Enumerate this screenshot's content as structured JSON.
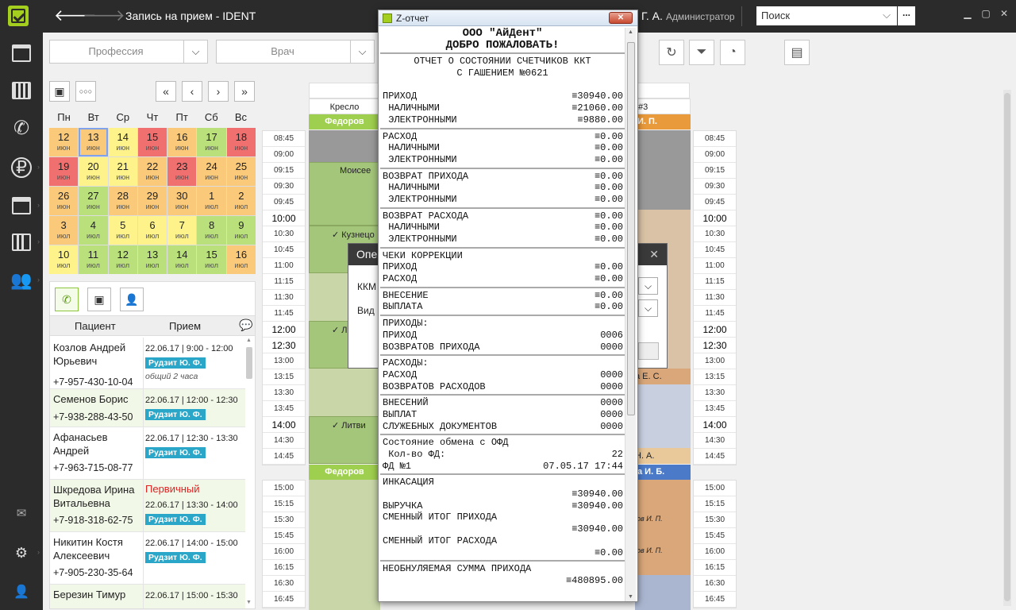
{
  "topbar": {
    "title": "Запись на прием  -  IDENT",
    "user_name": "Г. А.",
    "user_role": "Администратор",
    "search_placeholder": "Поиск",
    "search_more": "..."
  },
  "filters": {
    "profession": "Профессия",
    "doctor": "Врач"
  },
  "calendar": {
    "weekdays": [
      "Пн",
      "Вт",
      "Ср",
      "Чт",
      "Пт",
      "Сб",
      "Вс"
    ],
    "days": [
      {
        "d": "12",
        "m": "июн",
        "c": "orange"
      },
      {
        "d": "13",
        "m": "июн",
        "c": "orange",
        "sel": true
      },
      {
        "d": "14",
        "m": "июн",
        "c": "yellow"
      },
      {
        "d": "15",
        "m": "июн",
        "c": "red"
      },
      {
        "d": "16",
        "m": "июн",
        "c": "orange"
      },
      {
        "d": "17",
        "m": "июн",
        "c": "green"
      },
      {
        "d": "18",
        "m": "июн",
        "c": "red"
      },
      {
        "d": "19",
        "m": "июн",
        "c": "red"
      },
      {
        "d": "20",
        "m": "июн",
        "c": "yellow"
      },
      {
        "d": "21",
        "m": "июн",
        "c": "yellow"
      },
      {
        "d": "22",
        "m": "июн",
        "c": "orange"
      },
      {
        "d": "23",
        "m": "июн",
        "c": "red"
      },
      {
        "d": "24",
        "m": "июн",
        "c": "orange"
      },
      {
        "d": "25",
        "m": "июн",
        "c": "orange"
      },
      {
        "d": "26",
        "m": "июн",
        "c": "orange"
      },
      {
        "d": "27",
        "m": "июн",
        "c": "green"
      },
      {
        "d": "28",
        "m": "июн",
        "c": "orange"
      },
      {
        "d": "29",
        "m": "июн",
        "c": "orange"
      },
      {
        "d": "30",
        "m": "июн",
        "c": "orange"
      },
      {
        "d": "1",
        "m": "июл",
        "c": "orange"
      },
      {
        "d": "2",
        "m": "июл",
        "c": "orange"
      },
      {
        "d": "3",
        "m": "июл",
        "c": "orange"
      },
      {
        "d": "4",
        "m": "июл",
        "c": "green"
      },
      {
        "d": "5",
        "m": "июл",
        "c": "yellow"
      },
      {
        "d": "6",
        "m": "июл",
        "c": "yellow"
      },
      {
        "d": "7",
        "m": "июл",
        "c": "yellow"
      },
      {
        "d": "8",
        "m": "июл",
        "c": "green"
      },
      {
        "d": "9",
        "m": "июл",
        "c": "green"
      },
      {
        "d": "10",
        "m": "июл",
        "c": "yellow"
      },
      {
        "d": "11",
        "m": "июл",
        "c": "green"
      },
      {
        "d": "12",
        "m": "июл",
        "c": "green"
      },
      {
        "d": "13",
        "m": "июл",
        "c": "green"
      },
      {
        "d": "14",
        "m": "июл",
        "c": "green"
      },
      {
        "d": "15",
        "m": "июл",
        "c": "green"
      },
      {
        "d": "16",
        "m": "июл",
        "c": "orange"
      }
    ]
  },
  "patients": {
    "col_patient": "Пациент",
    "col_visit": "Прием",
    "rows": [
      {
        "name": "Козлов Андрей Юрьевич",
        "phone": "+7-957-430-10-04",
        "date": "22.06.17 | 9:00 - 12:00",
        "doctor": "Рудзит Ю. Ф.",
        "note": "общий 2 часа",
        "primary": ""
      },
      {
        "name": "Семенов Борис",
        "phone": "+7-938-288-43-50",
        "date": "22.06.17 | 12:00 - 12:30",
        "doctor": "Рудзит Ю. Ф.",
        "note": "",
        "primary": ""
      },
      {
        "name": "Афанасьев Андрей",
        "phone": "+7-963-715-08-77",
        "date": "22.06.17 | 12:30 - 13:30",
        "doctor": "Рудзит Ю. Ф.",
        "note": "",
        "primary": ""
      },
      {
        "name": "Шкредова Ирина Витальевна",
        "phone": "+7-918-318-62-75",
        "date": "22.06.17 | 13:30 - 14:00",
        "doctor": "Рудзит Ю. Ф.",
        "note": "",
        "primary": "Первичный"
      },
      {
        "name": "Никитин Костя Алексеевич",
        "phone": "+7-905-230-35-64",
        "date": "22.06.17 | 14:00 - 15:00",
        "doctor": "Рудзит Ю. Ф.",
        "note": "",
        "primary": ""
      },
      {
        "name": "Березин Тимур",
        "phone": "",
        "date": "22.06.17 | 15:00 - 15:30",
        "doctor": "",
        "note": "",
        "primary": ""
      }
    ]
  },
  "schedule": {
    "chair_left": "Кресло",
    "chair_right": "#3",
    "doctor_band_left": "Федоров",
    "doctor_band_right": "И. П.",
    "band2_left": "Федоров",
    "band2_right": "а И. Б.",
    "apt_1": "Моисее",
    "apt_2": "✓ Кузнецо",
    "apt_3": "✓ Л",
    "apt_4": "✓ Литви",
    "apt_r1": "а Е. С.",
    "apt_r2": "Н. А.",
    "note_r": "ов И. П.",
    "times_a": [
      "08:45",
      "09:00",
      "09:15",
      "09:30",
      "09:45",
      "10:00",
      "10:30",
      "10:45",
      "11:00",
      "11:15",
      "11:30",
      "11:45",
      "12:00",
      "12:30",
      "13:00",
      "13:15",
      "13:30",
      "13:45",
      "14:00",
      "14:30",
      "14:45"
    ],
    "times_b": [
      "15:00",
      "15:15",
      "15:30",
      "15:45",
      "16:00",
      "16:15",
      "16:30",
      "16:45"
    ]
  },
  "dialog": {
    "title": "Опе",
    "l1": "ККМ",
    "l2": "Вид"
  },
  "zreport": {
    "window_title": "Z-отчет",
    "lines": [
      {
        "t": "ООО \"АйДент\"",
        "cls": "c b"
      },
      {
        "t": "ДОБРО ПОЖАЛОВАТЬ!",
        "cls": "c b"
      },
      {
        "hr": true
      },
      {
        "t": "ОТЧЕТ О СОСТОЯНИИ СЧЕТЧИКОВ ККТ",
        "cls": "c"
      },
      {
        "t": "С ГАШЕНИЕМ №0621",
        "cls": "c"
      },
      {
        "t": "",
        "cls": ""
      },
      {
        "t": "ПРИХОД",
        "r": "≡30940.00"
      },
      {
        "t": " НАЛИЧНЫМИ",
        "r": "≡21060.00"
      },
      {
        "t": " ЭЛЕКТРОННЫМИ",
        "r": "≡9880.00"
      },
      {
        "hr": true
      },
      {
        "t": "РАСХОД",
        "r": "≡0.00"
      },
      {
        "t": " НАЛИЧНЫМИ",
        "r": "≡0.00"
      },
      {
        "t": " ЭЛЕКТРОННЫМИ",
        "r": "≡0.00"
      },
      {
        "hr": true
      },
      {
        "t": "ВОЗВРАТ ПРИХОДА",
        "r": "≡0.00"
      },
      {
        "t": " НАЛИЧНЫМИ",
        "r": "≡0.00"
      },
      {
        "t": " ЭЛЕКТРОННЫМИ",
        "r": "≡0.00"
      },
      {
        "hr": true
      },
      {
        "t": "ВОЗВРАТ РАСХОДА",
        "r": "≡0.00"
      },
      {
        "t": " НАЛИЧНЫМИ",
        "r": "≡0.00"
      },
      {
        "t": " ЭЛЕКТРОННЫМИ",
        "r": "≡0.00"
      },
      {
        "hr": true
      },
      {
        "t": "ЧЕКИ КОРРЕКЦИИ",
        "r": ""
      },
      {
        "t": "ПРИХОД",
        "r": "≡0.00"
      },
      {
        "t": "РАСХОД",
        "r": "≡0.00"
      },
      {
        "hr": true
      },
      {
        "t": "ВНЕСЕНИЕ",
        "r": "≡0.00"
      },
      {
        "t": "ВЫПЛАТА",
        "r": "≡0.00"
      },
      {
        "hr": true
      },
      {
        "t": "ПРИХОДЫ:",
        "r": ""
      },
      {
        "t": "ПРИХОД",
        "r": "0006"
      },
      {
        "t": "ВОЗВРАТОВ ПРИХОДА",
        "r": "0000"
      },
      {
        "hr": true
      },
      {
        "t": "РАСХОДЫ:",
        "r": ""
      },
      {
        "t": "РАСХОД",
        "r": "0000"
      },
      {
        "t": "ВОЗВРАТОВ РАСХОДОВ",
        "r": "0000"
      },
      {
        "hr": true
      },
      {
        "t": "ВНЕСЕНИЙ",
        "r": "0000"
      },
      {
        "t": "ВЫПЛАТ",
        "r": "0000"
      },
      {
        "t": "СЛУЖЕБНЫХ ДОКУМЕНТОВ",
        "r": "0000"
      },
      {
        "hr": true
      },
      {
        "t": "Состояние обмена с ОФД",
        "r": ""
      },
      {
        "t": " Кол-во ФД:",
        "r": "22"
      },
      {
        "t": "ФД №1",
        "r": "07.05.17 17:44"
      },
      {
        "hr": true
      },
      {
        "t": "ИНКАСАЦИЯ",
        "r": ""
      },
      {
        "t": "",
        "r": "≡30940.00"
      },
      {
        "t": "ВЫРУЧКА",
        "r": "≡30940.00"
      },
      {
        "t": "СМЕННЫЙ ИТОГ ПРИХОДА",
        "r": ""
      },
      {
        "t": "",
        "r": "≡30940.00"
      },
      {
        "t": "СМЕННЫЙ ИТОГ РАСХОДА",
        "r": ""
      },
      {
        "t": "",
        "r": "≡0.00"
      },
      {
        "hr": true
      },
      {
        "t": "НЕОБНУЛЯЕМАЯ СУММА ПРИХОДА",
        "r": ""
      },
      {
        "t": "",
        "r": "≡480895.00"
      }
    ]
  }
}
